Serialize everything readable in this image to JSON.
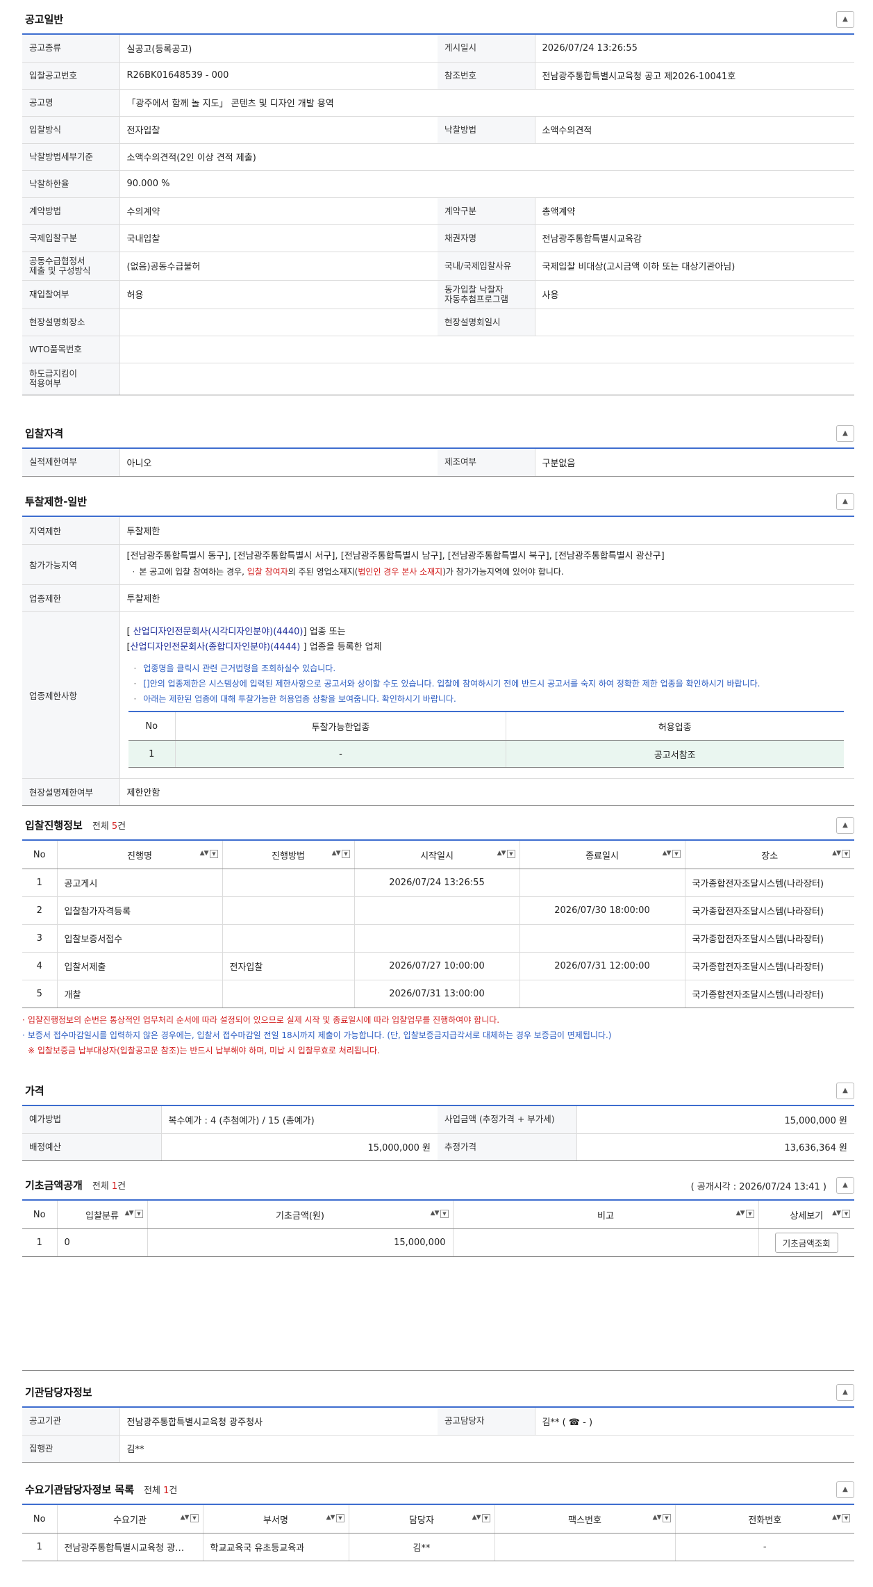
{
  "s1": {
    "title": "공고일반",
    "rows": [
      [
        "공고종류",
        "실공고(등록공고)",
        "게시일시",
        "2026/07/24 13:26:55"
      ],
      [
        "입찰공고번호",
        "R26BK01648539 - 000",
        "참조번호",
        "전남광주통합특별시교육청 공고 제2026-10041호"
      ],
      [
        "공고명",
        "「광주에서 함께 놀 지도」 콘텐츠 및 디자인 개발 용역"
      ],
      [
        "입찰방식",
        "전자입찰",
        "낙찰방법",
        "소액수의견적"
      ],
      [
        "낙찰방법세부기준",
        "소액수의견적(2인 이상 견적 제출)"
      ],
      [
        "낙찰하한율",
        "90.000 %"
      ],
      [
        "계약방법",
        "수의계약",
        "계약구분",
        "총액계약"
      ],
      [
        "국제입찰구분",
        "국내입찰",
        "채권자명",
        "전남광주통합특별시교육감"
      ],
      [
        "공동수급협정서\n제출 및 구성방식",
        "(없음)공동수급불허",
        "국내/국제입찰사유",
        "국제입찰 비대상(고시금액 이하 또는 대상기관아님)"
      ],
      [
        "재입찰여부",
        "허용",
        "동가입찰 낙찰자\n자동추첨프로그램",
        "사용"
      ],
      [
        "현장설명회장소",
        "",
        "현장설명회일시",
        ""
      ],
      [
        "WTO품목번호",
        ""
      ],
      [
        "하도급지킴이\n적용여부",
        ""
      ]
    ]
  },
  "s2": {
    "title": "입찰자격",
    "rows": [
      [
        "실적제한여부",
        "아니오",
        "제조여부",
        "구분없음"
      ]
    ]
  },
  "s3": {
    "title": "투찰제한-일반",
    "region_label": "지역제한",
    "region_value": "투찰제한",
    "areas_label": "참가가능지역",
    "areas_value": "[전남광주통합특별시 동구], [전남광주통합특별시 서구], [전남광주통합특별시 남구], [전남광주통합특별시 북구], [전남광주통합특별시 광산구]",
    "areas_note_a": "본 공고에 입찰 참여하는 경우, ",
    "areas_note_b": "입찰 참여자",
    "areas_note_c": "의 주된 영업소재지(",
    "areas_note_d": "법인인 경우 본사 소재지",
    "areas_note_e": ")가 참가가능지역에 있어야 합니다.",
    "industry_label": "업종제한",
    "industry_value": "투찰제한",
    "detail_label": "업종제한사항",
    "ind1": "산업디자인전문회사(시각디자인분야)(4440)",
    "ind_or": "업종 또는",
    "ind2": "산업디자인전문회사(종합디자인분야)(4444)",
    "ind_reg": "업종을 등록한 업체",
    "b1": "업종명을 클릭시 관련 근거법령을 조회하실수 있습니다.",
    "b2": "[]안의 업종제한은 시스템상에 입력된 제한사항으로 공고서와 상이할 수도 있습니다. 입찰에 참여하시기 전에 반드시 공고서를 숙지 하여 정확한 제한 업종을 확인하시기 바랍니다.",
    "b3": "아래는 제한된 업종에 대해 투찰가능한 허용업종 상황을 보여줍니다. 확인하시기 바랍니다.",
    "inner_headers": [
      "No",
      "투찰가능한업종",
      "허용업종"
    ],
    "inner_row": [
      "1",
      "-",
      "공고서참조"
    ],
    "site_label": "현장설명제한여부",
    "site_value": "제한안함"
  },
  "s4": {
    "title": "입찰진행정보",
    "count_prefix": "전체",
    "count": "5",
    "count_suffix": "건",
    "headers": [
      "No",
      "진행명",
      "진행방법",
      "시작일시",
      "종료일시",
      "장소"
    ],
    "rows": [
      [
        "1",
        "공고게시",
        "",
        "2026/07/24 13:26:55",
        "",
        "국가종합전자조달시스템(나라장터)"
      ],
      [
        "2",
        "입찰참가자격등록",
        "",
        "",
        "2026/07/30 18:00:00",
        "국가종합전자조달시스템(나라장터)"
      ],
      [
        "3",
        "입찰보증서접수",
        "",
        "",
        "",
        "국가종합전자조달시스템(나라장터)"
      ],
      [
        "4",
        "입찰서제출",
        "전자입찰",
        "2026/07/27 10:00:00",
        "2026/07/31 12:00:00",
        "국가종합전자조달시스템(나라장터)"
      ],
      [
        "5",
        "개찰",
        "",
        "2026/07/31 13:00:00",
        "",
        "국가종합전자조달시스템(나라장터)"
      ]
    ],
    "n1": "입찰진행정보의 순번은 통상적인 업무처리 순서에 따라 설정되어 있으므로 실제 시작 및 종료일시에 따라 입찰업무를 진행하여야 합니다.",
    "n2": "보증서 접수마감일시를 입력하지 않은 경우에는, 입찰서 접수마감일 전일 18시까지 제출이 가능합니다. (단, 입찰보증금지급각서로 대체하는 경우 보증금이 면제됩니다.)",
    "n3": "※ 입찰보증금 납부대상자(입찰공고문 참조)는 반드시 납부해야 하며, 미납 시 입찰무효로 처리됩니다."
  },
  "s5": {
    "title": "가격",
    "rows": [
      [
        "예가방법",
        "복수예가 : 4 (추첨예가) / 15 (총예가)",
        "사업금액 (추정가격 + 부가세)",
        "15,000,000 원"
      ],
      [
        "배정예산",
        "15,000,000 원",
        "추정가격",
        "13,636,364 원"
      ]
    ]
  },
  "s6": {
    "title": "기초금액공개",
    "count_prefix": "전체",
    "count": "1",
    "count_suffix": "건",
    "open_time": "( 공개시각 : 2026/07/24 13:41 )",
    "headers": [
      "No",
      "입찰분류",
      "기초금액(원)",
      "비고",
      "상세보기"
    ],
    "row": [
      "1",
      "0",
      "15,000,000",
      ""
    ],
    "button": "기초금액조회"
  },
  "s7": {
    "title": "기관담당자정보",
    "rows": [
      [
        "공고기관",
        "전남광주통합특별시교육청 광주청사",
        "공고담당자",
        "김** ( ☎ - )"
      ],
      [
        "집행관",
        "김**"
      ]
    ]
  },
  "s8": {
    "title": "수요기관담당자정보 목록",
    "count_prefix": "전체",
    "count": "1",
    "count_suffix": "건",
    "headers": [
      "No",
      "수요기관",
      "부서명",
      "담당자",
      "팩스번호",
      "전화번호"
    ],
    "row": [
      "1",
      "전남광주통합특별시교육청 광…",
      "학교교육국 유초등교육과",
      "김**",
      "",
      "-"
    ]
  },
  "toggle": "^"
}
